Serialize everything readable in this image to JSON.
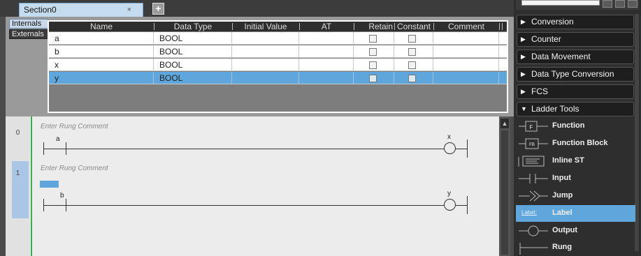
{
  "section_tab": {
    "label": "Section0",
    "close": "×",
    "add": "+"
  },
  "variable_tabs": {
    "internals": "Internals",
    "externals": "Externals"
  },
  "table": {
    "columns": [
      "Name",
      "Data Type",
      "Initial Value",
      "AT",
      "Retain",
      "Constant",
      "Comment"
    ],
    "rows": [
      {
        "name": "a",
        "data_type": "BOOL",
        "selected": false
      },
      {
        "name": "b",
        "data_type": "BOOL",
        "selected": false
      },
      {
        "name": "x",
        "data_type": "BOOL",
        "selected": false
      },
      {
        "name": "y",
        "data_type": "BOOL",
        "selected": true
      }
    ]
  },
  "rungs": [
    {
      "number": "0",
      "comment": "Enter Rung Comment",
      "contact": "a",
      "coil": "x"
    },
    {
      "number": "1",
      "comment": "Enter Rung Comment",
      "contact": "b",
      "coil": "y"
    }
  ],
  "toolbox": {
    "search_placeholder": "",
    "categories": [
      {
        "label": "Conversion",
        "expanded": false
      },
      {
        "label": "Counter",
        "expanded": false
      },
      {
        "label": "Data Movement",
        "expanded": false
      },
      {
        "label": "Data Type Conversion",
        "expanded": false
      },
      {
        "label": "FCS",
        "expanded": false
      },
      {
        "label": "Ladder Tools",
        "expanded": true
      }
    ],
    "items": [
      {
        "label": "Function",
        "icon": "F",
        "icon_name": "function-icon"
      },
      {
        "label": "Function Block",
        "icon": "FB",
        "icon_name": "function-block-icon"
      },
      {
        "label": "Inline ST",
        "icon": "",
        "icon_name": "inline-st-icon"
      },
      {
        "label": "Input",
        "icon": "",
        "icon_name": "input-contact-icon"
      },
      {
        "label": "Jump",
        "icon": "",
        "icon_name": "jump-icon"
      },
      {
        "label": "Label",
        "icon": "Label:",
        "icon_name": "label-icon",
        "selected": true
      },
      {
        "label": "Output",
        "icon": "",
        "icon_name": "output-coil-icon"
      },
      {
        "label": "Rung",
        "icon": "",
        "icon_name": "rung-icon"
      }
    ]
  },
  "colors": {
    "accent": "#5fa6dc",
    "rail": "#37b34a",
    "tab": "#c5dcef"
  }
}
